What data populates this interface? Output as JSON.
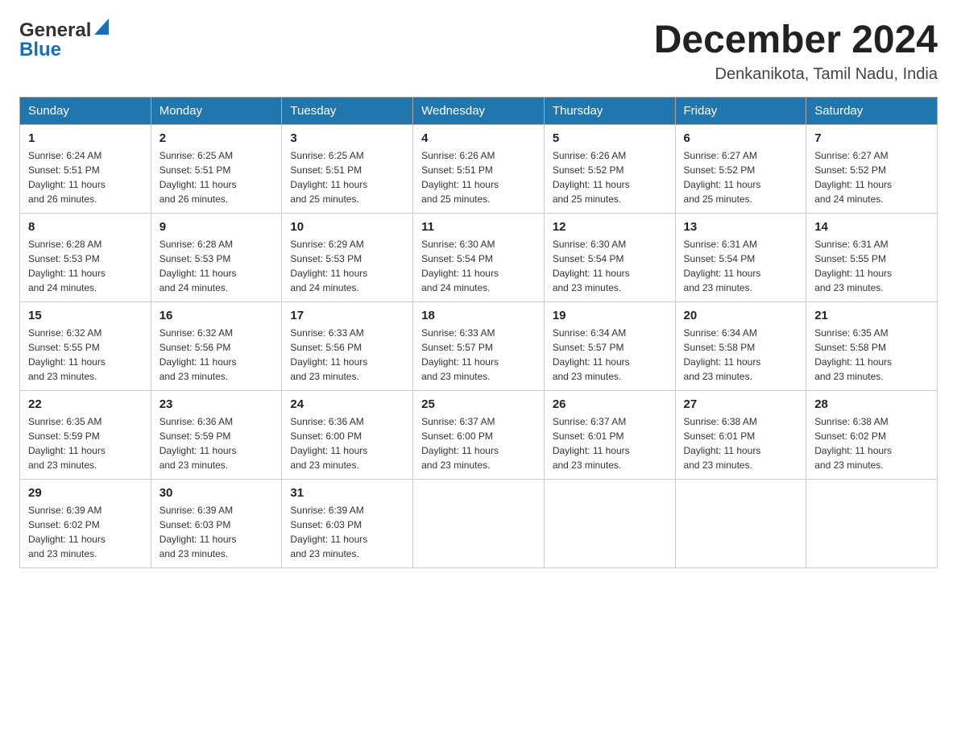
{
  "header": {
    "logo_line1": "General",
    "logo_line2": "Blue",
    "month_title": "December 2024",
    "location": "Denkanikota, Tamil Nadu, India"
  },
  "days_of_week": [
    "Sunday",
    "Monday",
    "Tuesday",
    "Wednesday",
    "Thursday",
    "Friday",
    "Saturday"
  ],
  "weeks": [
    [
      {
        "day": "1",
        "sunrise": "6:24 AM",
        "sunset": "5:51 PM",
        "daylight": "11 hours and 26 minutes."
      },
      {
        "day": "2",
        "sunrise": "6:25 AM",
        "sunset": "5:51 PM",
        "daylight": "11 hours and 26 minutes."
      },
      {
        "day": "3",
        "sunrise": "6:25 AM",
        "sunset": "5:51 PM",
        "daylight": "11 hours and 25 minutes."
      },
      {
        "day": "4",
        "sunrise": "6:26 AM",
        "sunset": "5:51 PM",
        "daylight": "11 hours and 25 minutes."
      },
      {
        "day": "5",
        "sunrise": "6:26 AM",
        "sunset": "5:52 PM",
        "daylight": "11 hours and 25 minutes."
      },
      {
        "day": "6",
        "sunrise": "6:27 AM",
        "sunset": "5:52 PM",
        "daylight": "11 hours and 25 minutes."
      },
      {
        "day": "7",
        "sunrise": "6:27 AM",
        "sunset": "5:52 PM",
        "daylight": "11 hours and 24 minutes."
      }
    ],
    [
      {
        "day": "8",
        "sunrise": "6:28 AM",
        "sunset": "5:53 PM",
        "daylight": "11 hours and 24 minutes."
      },
      {
        "day": "9",
        "sunrise": "6:28 AM",
        "sunset": "5:53 PM",
        "daylight": "11 hours and 24 minutes."
      },
      {
        "day": "10",
        "sunrise": "6:29 AM",
        "sunset": "5:53 PM",
        "daylight": "11 hours and 24 minutes."
      },
      {
        "day": "11",
        "sunrise": "6:30 AM",
        "sunset": "5:54 PM",
        "daylight": "11 hours and 24 minutes."
      },
      {
        "day": "12",
        "sunrise": "6:30 AM",
        "sunset": "5:54 PM",
        "daylight": "11 hours and 23 minutes."
      },
      {
        "day": "13",
        "sunrise": "6:31 AM",
        "sunset": "5:54 PM",
        "daylight": "11 hours and 23 minutes."
      },
      {
        "day": "14",
        "sunrise": "6:31 AM",
        "sunset": "5:55 PM",
        "daylight": "11 hours and 23 minutes."
      }
    ],
    [
      {
        "day": "15",
        "sunrise": "6:32 AM",
        "sunset": "5:55 PM",
        "daylight": "11 hours and 23 minutes."
      },
      {
        "day": "16",
        "sunrise": "6:32 AM",
        "sunset": "5:56 PM",
        "daylight": "11 hours and 23 minutes."
      },
      {
        "day": "17",
        "sunrise": "6:33 AM",
        "sunset": "5:56 PM",
        "daylight": "11 hours and 23 minutes."
      },
      {
        "day": "18",
        "sunrise": "6:33 AM",
        "sunset": "5:57 PM",
        "daylight": "11 hours and 23 minutes."
      },
      {
        "day": "19",
        "sunrise": "6:34 AM",
        "sunset": "5:57 PM",
        "daylight": "11 hours and 23 minutes."
      },
      {
        "day": "20",
        "sunrise": "6:34 AM",
        "sunset": "5:58 PM",
        "daylight": "11 hours and 23 minutes."
      },
      {
        "day": "21",
        "sunrise": "6:35 AM",
        "sunset": "5:58 PM",
        "daylight": "11 hours and 23 minutes."
      }
    ],
    [
      {
        "day": "22",
        "sunrise": "6:35 AM",
        "sunset": "5:59 PM",
        "daylight": "11 hours and 23 minutes."
      },
      {
        "day": "23",
        "sunrise": "6:36 AM",
        "sunset": "5:59 PM",
        "daylight": "11 hours and 23 minutes."
      },
      {
        "day": "24",
        "sunrise": "6:36 AM",
        "sunset": "6:00 PM",
        "daylight": "11 hours and 23 minutes."
      },
      {
        "day": "25",
        "sunrise": "6:37 AM",
        "sunset": "6:00 PM",
        "daylight": "11 hours and 23 minutes."
      },
      {
        "day": "26",
        "sunrise": "6:37 AM",
        "sunset": "6:01 PM",
        "daylight": "11 hours and 23 minutes."
      },
      {
        "day": "27",
        "sunrise": "6:38 AM",
        "sunset": "6:01 PM",
        "daylight": "11 hours and 23 minutes."
      },
      {
        "day": "28",
        "sunrise": "6:38 AM",
        "sunset": "6:02 PM",
        "daylight": "11 hours and 23 minutes."
      }
    ],
    [
      {
        "day": "29",
        "sunrise": "6:39 AM",
        "sunset": "6:02 PM",
        "daylight": "11 hours and 23 minutes."
      },
      {
        "day": "30",
        "sunrise": "6:39 AM",
        "sunset": "6:03 PM",
        "daylight": "11 hours and 23 minutes."
      },
      {
        "day": "31",
        "sunrise": "6:39 AM",
        "sunset": "6:03 PM",
        "daylight": "11 hours and 23 minutes."
      },
      null,
      null,
      null,
      null
    ]
  ],
  "labels": {
    "sunrise": "Sunrise: ",
    "sunset": "Sunset: ",
    "daylight": "Daylight: "
  }
}
